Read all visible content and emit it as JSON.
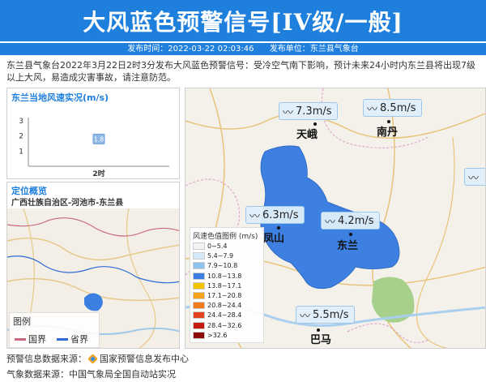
{
  "banner": {
    "title": "大风蓝色预警信号[IV级/一般]",
    "publish_time": "发布时间：2022-03-22 02:03:46",
    "publisher": "发布单位：东兰县气象台",
    "color": "#1e7fdc"
  },
  "description": "东兰县气象台2022年3月22日2时3分发布大风蓝色预警信号：受冷空气南下影响，预计未来24小时内东兰县将出现7级以上大风，易造成灾害事故，请注意防范。",
  "wind_panel": {
    "title": "东兰当地风速实况(m/s)",
    "chart_data": {
      "type": "bar",
      "categories": [
        "2时"
      ],
      "values": [
        1.8
      ],
      "ylim": [
        0,
        3
      ],
      "yticks": [
        "1",
        "2",
        "3"
      ],
      "data_label": "1.8"
    }
  },
  "location_panel": {
    "title": "定位概览",
    "region": "广西壮族自治区-河池市-东兰县",
    "legend": {
      "title": "图例",
      "items": [
        {
          "label": "国界",
          "color": "#c9677d"
        },
        {
          "label": "省界",
          "color": "#2e6bd6"
        }
      ]
    }
  },
  "main_map": {
    "stations": [
      {
        "speed": "7.3m/s",
        "city": "天峨"
      },
      {
        "speed": "8.5m/s",
        "city": "南丹"
      },
      {
        "speed": "6.3m/s",
        "city": "凤山"
      },
      {
        "speed": "4.2m/s",
        "city": "东兰"
      },
      {
        "speed": "5.5m/s",
        "city": "巴马"
      }
    ],
    "wind_icon": "wind-icon",
    "scale": {
      "title": "风速色值图例 (m/s)",
      "items": [
        {
          "label": "0~5.4",
          "color": "#f2f2f2"
        },
        {
          "label": "5.4~7.9",
          "color": "#d6e9f8"
        },
        {
          "label": "7.9~10.8",
          "color": "#8fc3ef"
        },
        {
          "label": "10.8~13.8",
          "color": "#3b7fe0"
        },
        {
          "label": "13.8~17.1",
          "color": "#f5c400"
        },
        {
          "label": "17.1~20.8",
          "color": "#f7a21b"
        },
        {
          "label": "20.8~24.4",
          "color": "#f07b1c"
        },
        {
          "label": "24.4~28.4",
          "color": "#e3421f"
        },
        {
          "label": "28.4~32.6",
          "color": "#c51a12"
        },
        {
          "label": ">32.6",
          "color": "#8c0a08"
        }
      ]
    }
  },
  "footer": {
    "warning_source_label": "预警信息数据来源：",
    "warning_source": "国家预警信息发布中心",
    "weather_source": "气象数据来源：中国气象局全国自动站实况"
  }
}
